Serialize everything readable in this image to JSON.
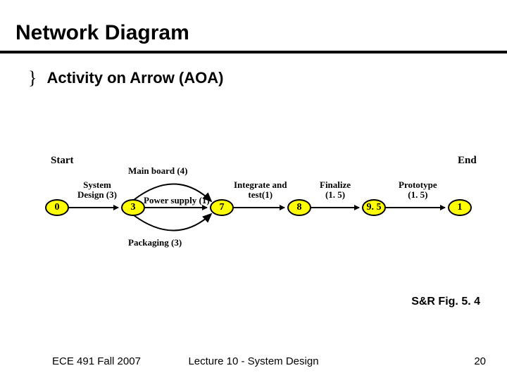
{
  "title": "Network Diagram",
  "bullet": "Activity on Arrow (AOA)",
  "labels": {
    "start": "Start",
    "end": "End"
  },
  "nodes": {
    "n0": "0",
    "n3": "3",
    "n7": "7",
    "n8": "8",
    "n95": "9. 5",
    "n1": "1"
  },
  "edges": {
    "mainboard": "Main board (4)",
    "sysdesign_l1": "System",
    "sysdesign_l2": "Design (3)",
    "power": "Power supply (1)",
    "integrate_l1": "Integrate and",
    "integrate_l2": "test(1)",
    "finalize_l1": "Finalize",
    "finalize_l2": "(1. 5)",
    "proto_l1": "Prototype",
    "proto_l2": "(1. 5)",
    "packaging": "Packaging (3)"
  },
  "caption": "S&R Fig. 5. 4",
  "footer": {
    "left": "ECE 491 Fall 2007",
    "center": "Lecture 10 - System Design",
    "right": "20"
  },
  "chart_data": {
    "type": "diagram",
    "subtype": "activity-on-arrow",
    "nodes": [
      0,
      3,
      7,
      8,
      9.5,
      1
    ],
    "edges": [
      {
        "from": 0,
        "to": 3,
        "label": "System Design",
        "duration": 3
      },
      {
        "from": 3,
        "to": 7,
        "label": "Main board",
        "duration": 4
      },
      {
        "from": 3,
        "to": 7,
        "label": "Power supply",
        "duration": 1
      },
      {
        "from": 3,
        "to": 7,
        "label": "Packaging",
        "duration": 3
      },
      {
        "from": 7,
        "to": 8,
        "label": "Integrate and test",
        "duration": 1
      },
      {
        "from": 8,
        "to": 9.5,
        "label": "Finalize",
        "duration": 1.5
      },
      {
        "from": 9.5,
        "to": 1,
        "label": "Prototype",
        "duration": 1.5
      }
    ],
    "start_node": 0,
    "end_node": 1
  }
}
